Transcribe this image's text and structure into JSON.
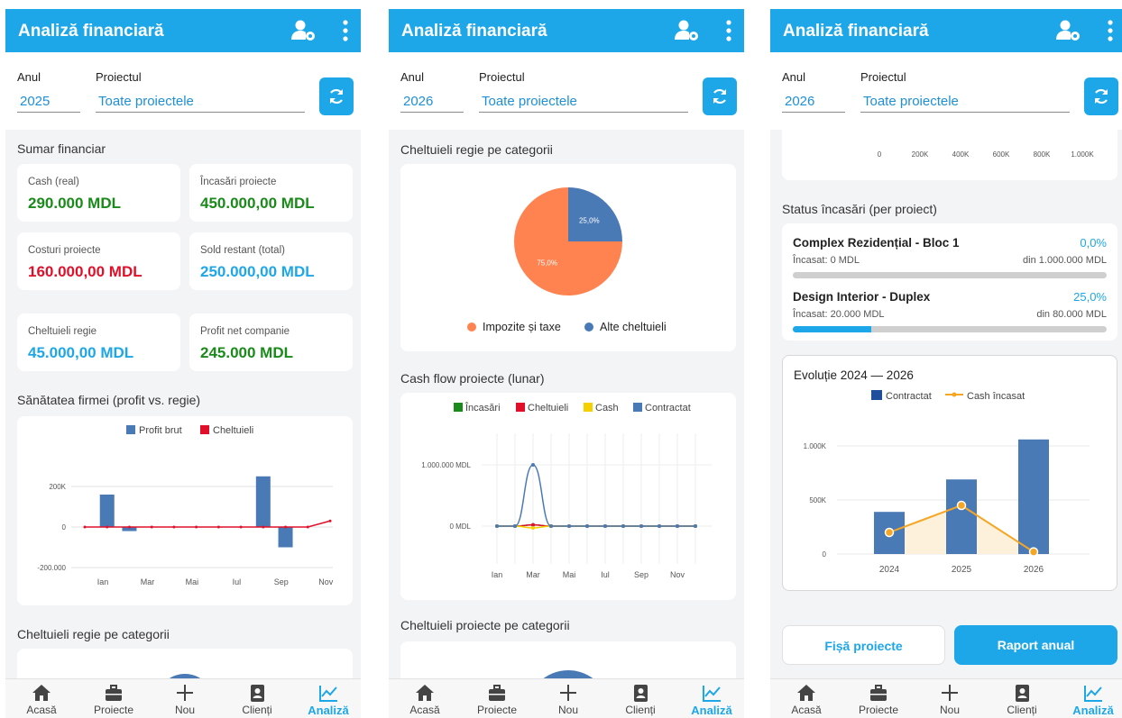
{
  "app_title": "Analiză financiară",
  "filter": {
    "year_label": "Anul",
    "project_label": "Proiectul",
    "project_value": "Toate proiectele"
  },
  "screens": [
    {
      "year": "2025"
    },
    {
      "year": "2026"
    },
    {
      "year": "2026"
    }
  ],
  "summary": {
    "title": "Sumar financiar",
    "cards": [
      {
        "label": "Cash (real)",
        "value": "290.000 MDL",
        "color": "#1a8a1a"
      },
      {
        "label": "Încasări proiecte",
        "value": "450.000,00 MDL",
        "color": "#1a8a1a"
      },
      {
        "label": "Costuri proiecte",
        "value": "160.000,00 MDL",
        "color": "#e0102a"
      },
      {
        "label": "Sold restant (total)",
        "value": "250.000,00 MDL",
        "color": "#1ea7e8"
      },
      {
        "label": "Cheltuieli regie",
        "value": "45.000,00 MDL",
        "color": "#1ea7e8"
      },
      {
        "label": "Profit net companie",
        "value": "245.000 MDL",
        "color": "#1a8a1a"
      }
    ]
  },
  "health_title": "Sănătatea firmei (profit vs. regie)",
  "regie_title": "Cheltuieli regie pe categorii",
  "cashflow_title": "Cash flow proiecte (lunar)",
  "proj_cat_title": "Cheltuieli proiecte pe categorii",
  "status_title": "Status încasări (per proiect)",
  "projects": [
    {
      "name": "Complex Rezidențial - Bloc 1",
      "pct": "0,0%",
      "collected": "Încasat: 0 MDL",
      "total": "din 1.000.000 MDL",
      "fraction": 0.0
    },
    {
      "name": "Design Interior - Duplex",
      "pct": "25,0%",
      "collected": "Încasat: 20.000 MDL",
      "total": "din 80.000 MDL",
      "fraction": 0.25
    }
  ],
  "buttons": {
    "fisa": "Fișă proiecte",
    "raport": "Raport anual"
  },
  "nav": [
    {
      "label": "Acasă",
      "icon": "home-icon"
    },
    {
      "label": "Proiecte",
      "icon": "briefcase-icon"
    },
    {
      "label": "Nou",
      "icon": "plus-icon"
    },
    {
      "label": "Clienți",
      "icon": "contacts-icon"
    },
    {
      "label": "Analiză",
      "icon": "chart-icon"
    }
  ],
  "colors": {
    "accent": "#1ea7e8",
    "bar_blue": "#4a7ab5",
    "red": "#e0102a",
    "orange": "#ff8350",
    "amber": "#f5a623"
  },
  "chart_data": [
    {
      "type": "bar",
      "legend": [
        "Profit brut",
        "Cheltuieli"
      ],
      "months": [
        "Ian",
        "Feb",
        "Mar",
        "Apr",
        "Mai",
        "Iun",
        "Iul",
        "Aug",
        "Sep",
        "Oct",
        "Nov",
        "Dec"
      ],
      "tick_labels": [
        "Ian",
        "Mar",
        "Mai",
        "Iul",
        "Sep",
        "Nov"
      ],
      "y_ticks": [
        "200K",
        "0",
        "-200.000"
      ],
      "ylim": [
        -200000,
        200000
      ],
      "series": [
        {
          "name": "Profit brut",
          "values": [
            0,
            160000,
            -20000,
            0,
            0,
            0,
            0,
            0,
            250000,
            -100000,
            0,
            0
          ]
        },
        {
          "name": "Cheltuieli",
          "values": [
            0,
            0,
            0,
            0,
            0,
            0,
            0,
            0,
            0,
            0,
            0,
            30000
          ]
        }
      ]
    },
    {
      "type": "pie",
      "slices": [
        {
          "name": "Impozite și taxe",
          "value": 75.0,
          "label": "75,0%",
          "color": "#ff8350"
        },
        {
          "name": "Alte cheltuieli",
          "value": 25.0,
          "label": "25,0%",
          "color": "#4a7ab5"
        }
      ]
    },
    {
      "type": "line",
      "legend": [
        {
          "name": "Încasări",
          "color": "#1a8a1a"
        },
        {
          "name": "Cheltuieli",
          "color": "#e0102a"
        },
        {
          "name": "Cash",
          "color": "#f5d000"
        },
        {
          "name": "Contractat",
          "color": "#4a7ab5"
        }
      ],
      "tick_labels": [
        "Ian",
        "Mar",
        "Mai",
        "Iul",
        "Sep",
        "Nov"
      ],
      "y_ticks": [
        "1.000.000 MDL",
        "0 MDL"
      ],
      "series": [
        {
          "name": "Contractat",
          "values": [
            0,
            0,
            1000000,
            0,
            0,
            0,
            0,
            0,
            0,
            0,
            0,
            0
          ]
        },
        {
          "name": "Încasări",
          "values": [
            0,
            0,
            20000,
            0,
            0,
            0,
            0,
            0,
            0,
            0,
            0,
            0
          ]
        },
        {
          "name": "Cheltuieli",
          "values": [
            0,
            0,
            20000,
            0,
            0,
            0,
            0,
            0,
            0,
            0,
            0,
            0
          ]
        },
        {
          "name": "Cash",
          "values": [
            0,
            0,
            -30000,
            0,
            0,
            0,
            0,
            0,
            0,
            0,
            0,
            0
          ]
        }
      ]
    },
    {
      "type": "bar",
      "x_ticks": [
        "0",
        "200K",
        "400K",
        "600K",
        "800K",
        "1.000K"
      ]
    },
    {
      "type": "bar",
      "title": "Evoluție 2024 — 2026",
      "legend": [
        {
          "name": "Contractat",
          "kind": "bar"
        },
        {
          "name": "Cash încasat",
          "kind": "line"
        }
      ],
      "categories": [
        "2024",
        "2025",
        "2026"
      ],
      "y_ticks": [
        "1.000K",
        "500K",
        "0"
      ],
      "ylim": [
        0,
        1250000
      ],
      "series": [
        {
          "name": "Contractat",
          "values": [
            390000,
            690000,
            1060000
          ]
        },
        {
          "name": "Cash încasat",
          "values": [
            200000,
            450000,
            20000
          ]
        }
      ]
    }
  ]
}
